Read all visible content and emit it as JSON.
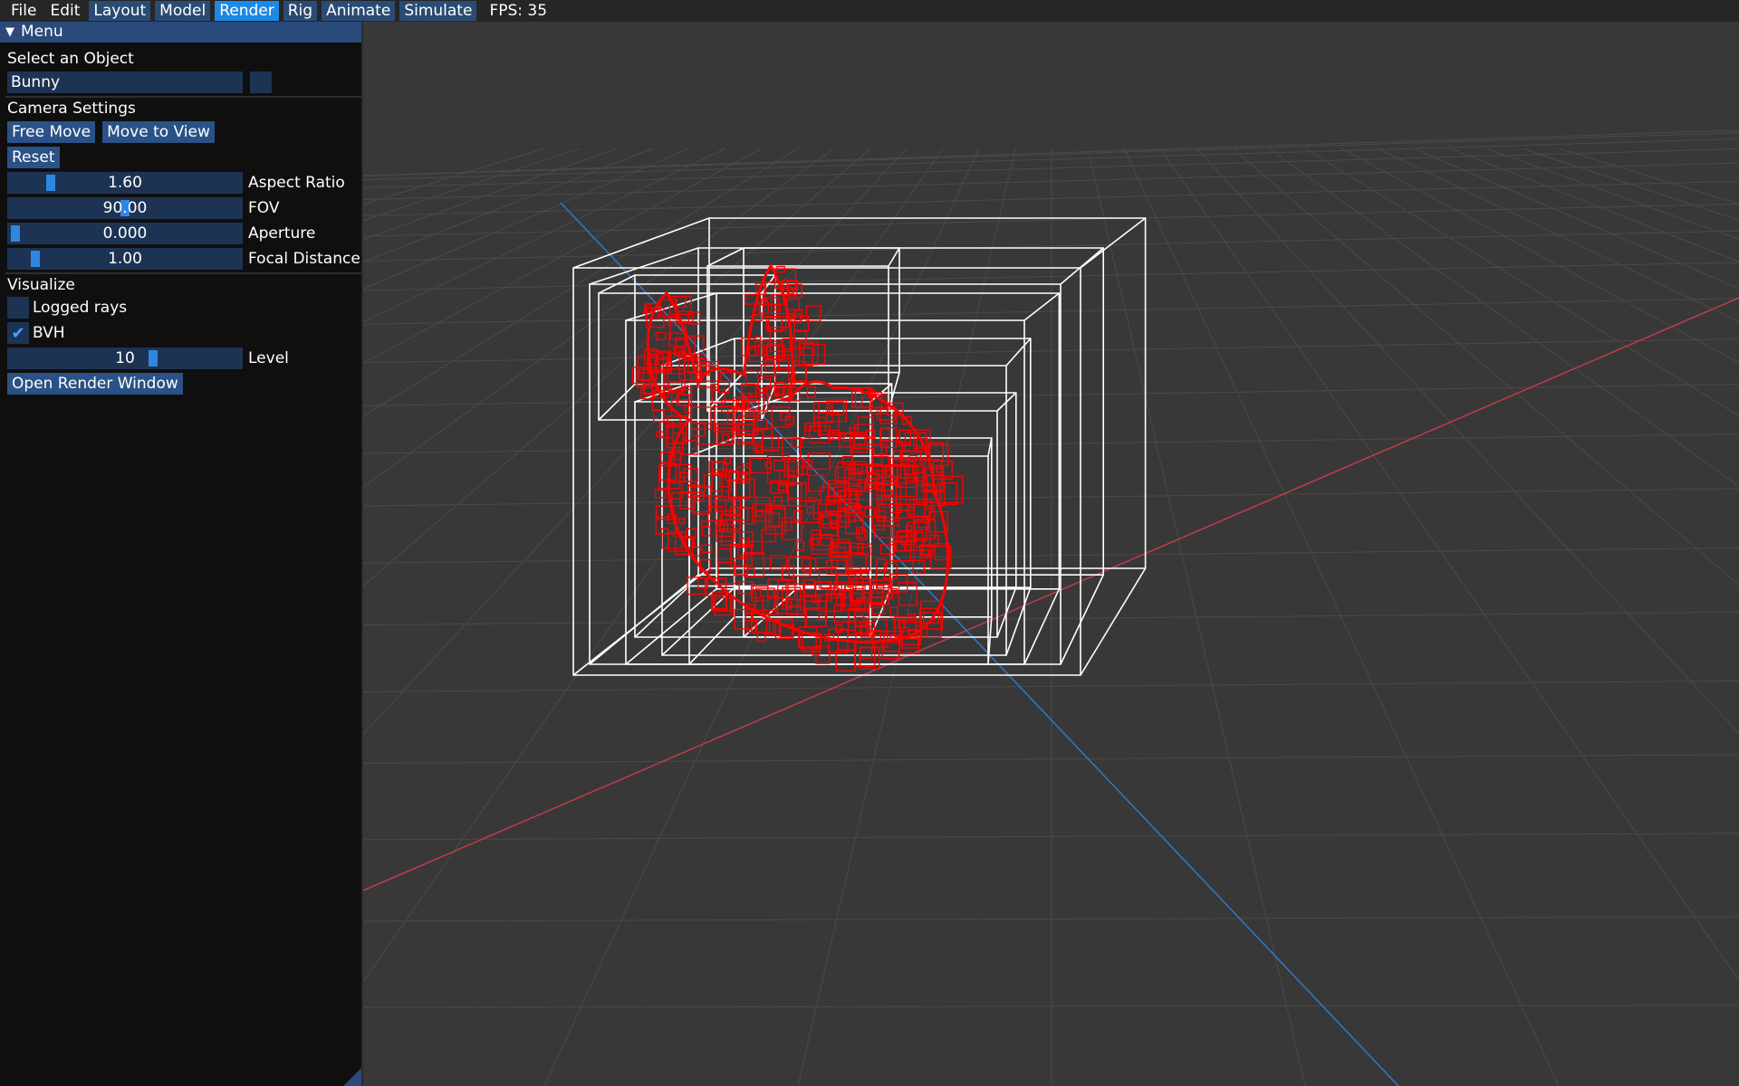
{
  "menubar": {
    "items": [
      "File",
      "Edit"
    ],
    "modes": [
      "Layout",
      "Model",
      "Render",
      "Rig",
      "Animate",
      "Simulate"
    ],
    "active_mode": "Render",
    "fps": "FPS: 35"
  },
  "panel": {
    "title": "Menu",
    "select_label": "Select an Object",
    "selected_object": "Bunny",
    "camera_heading": "Camera Settings",
    "buttons": {
      "free_move": "Free Move",
      "move_to_view": "Move to View",
      "reset": "Reset"
    },
    "sliders": [
      {
        "value": "1.60",
        "label": "Aspect Ratio",
        "fraction": 0.16
      },
      {
        "value": "90.00",
        "label": "FOV",
        "fraction": 0.5
      },
      {
        "value": "0.000",
        "label": "Aperture",
        "fraction": 0.0
      },
      {
        "value": "1.00",
        "label": "Focal Distance",
        "fraction": 0.09
      }
    ],
    "visualize_heading": "Visualize",
    "logged_rays": {
      "label": "Logged rays",
      "checked": false
    },
    "bvh": {
      "label": "BVH",
      "checked": true
    },
    "level": {
      "value": "10",
      "label": "Level",
      "fraction": 0.63
    },
    "open_render_window": "Open Render Window"
  },
  "colors": {
    "accent": "#1e88e5",
    "panel_bg": "#0f0f0f",
    "widget_bg": "#1d3354",
    "viewport_bg": "#383838",
    "x_axis": "#c23b4b",
    "z_axis": "#2f79c8",
    "bvh_outer": "#ffffff",
    "bvh_leaf": "#ff0000"
  }
}
